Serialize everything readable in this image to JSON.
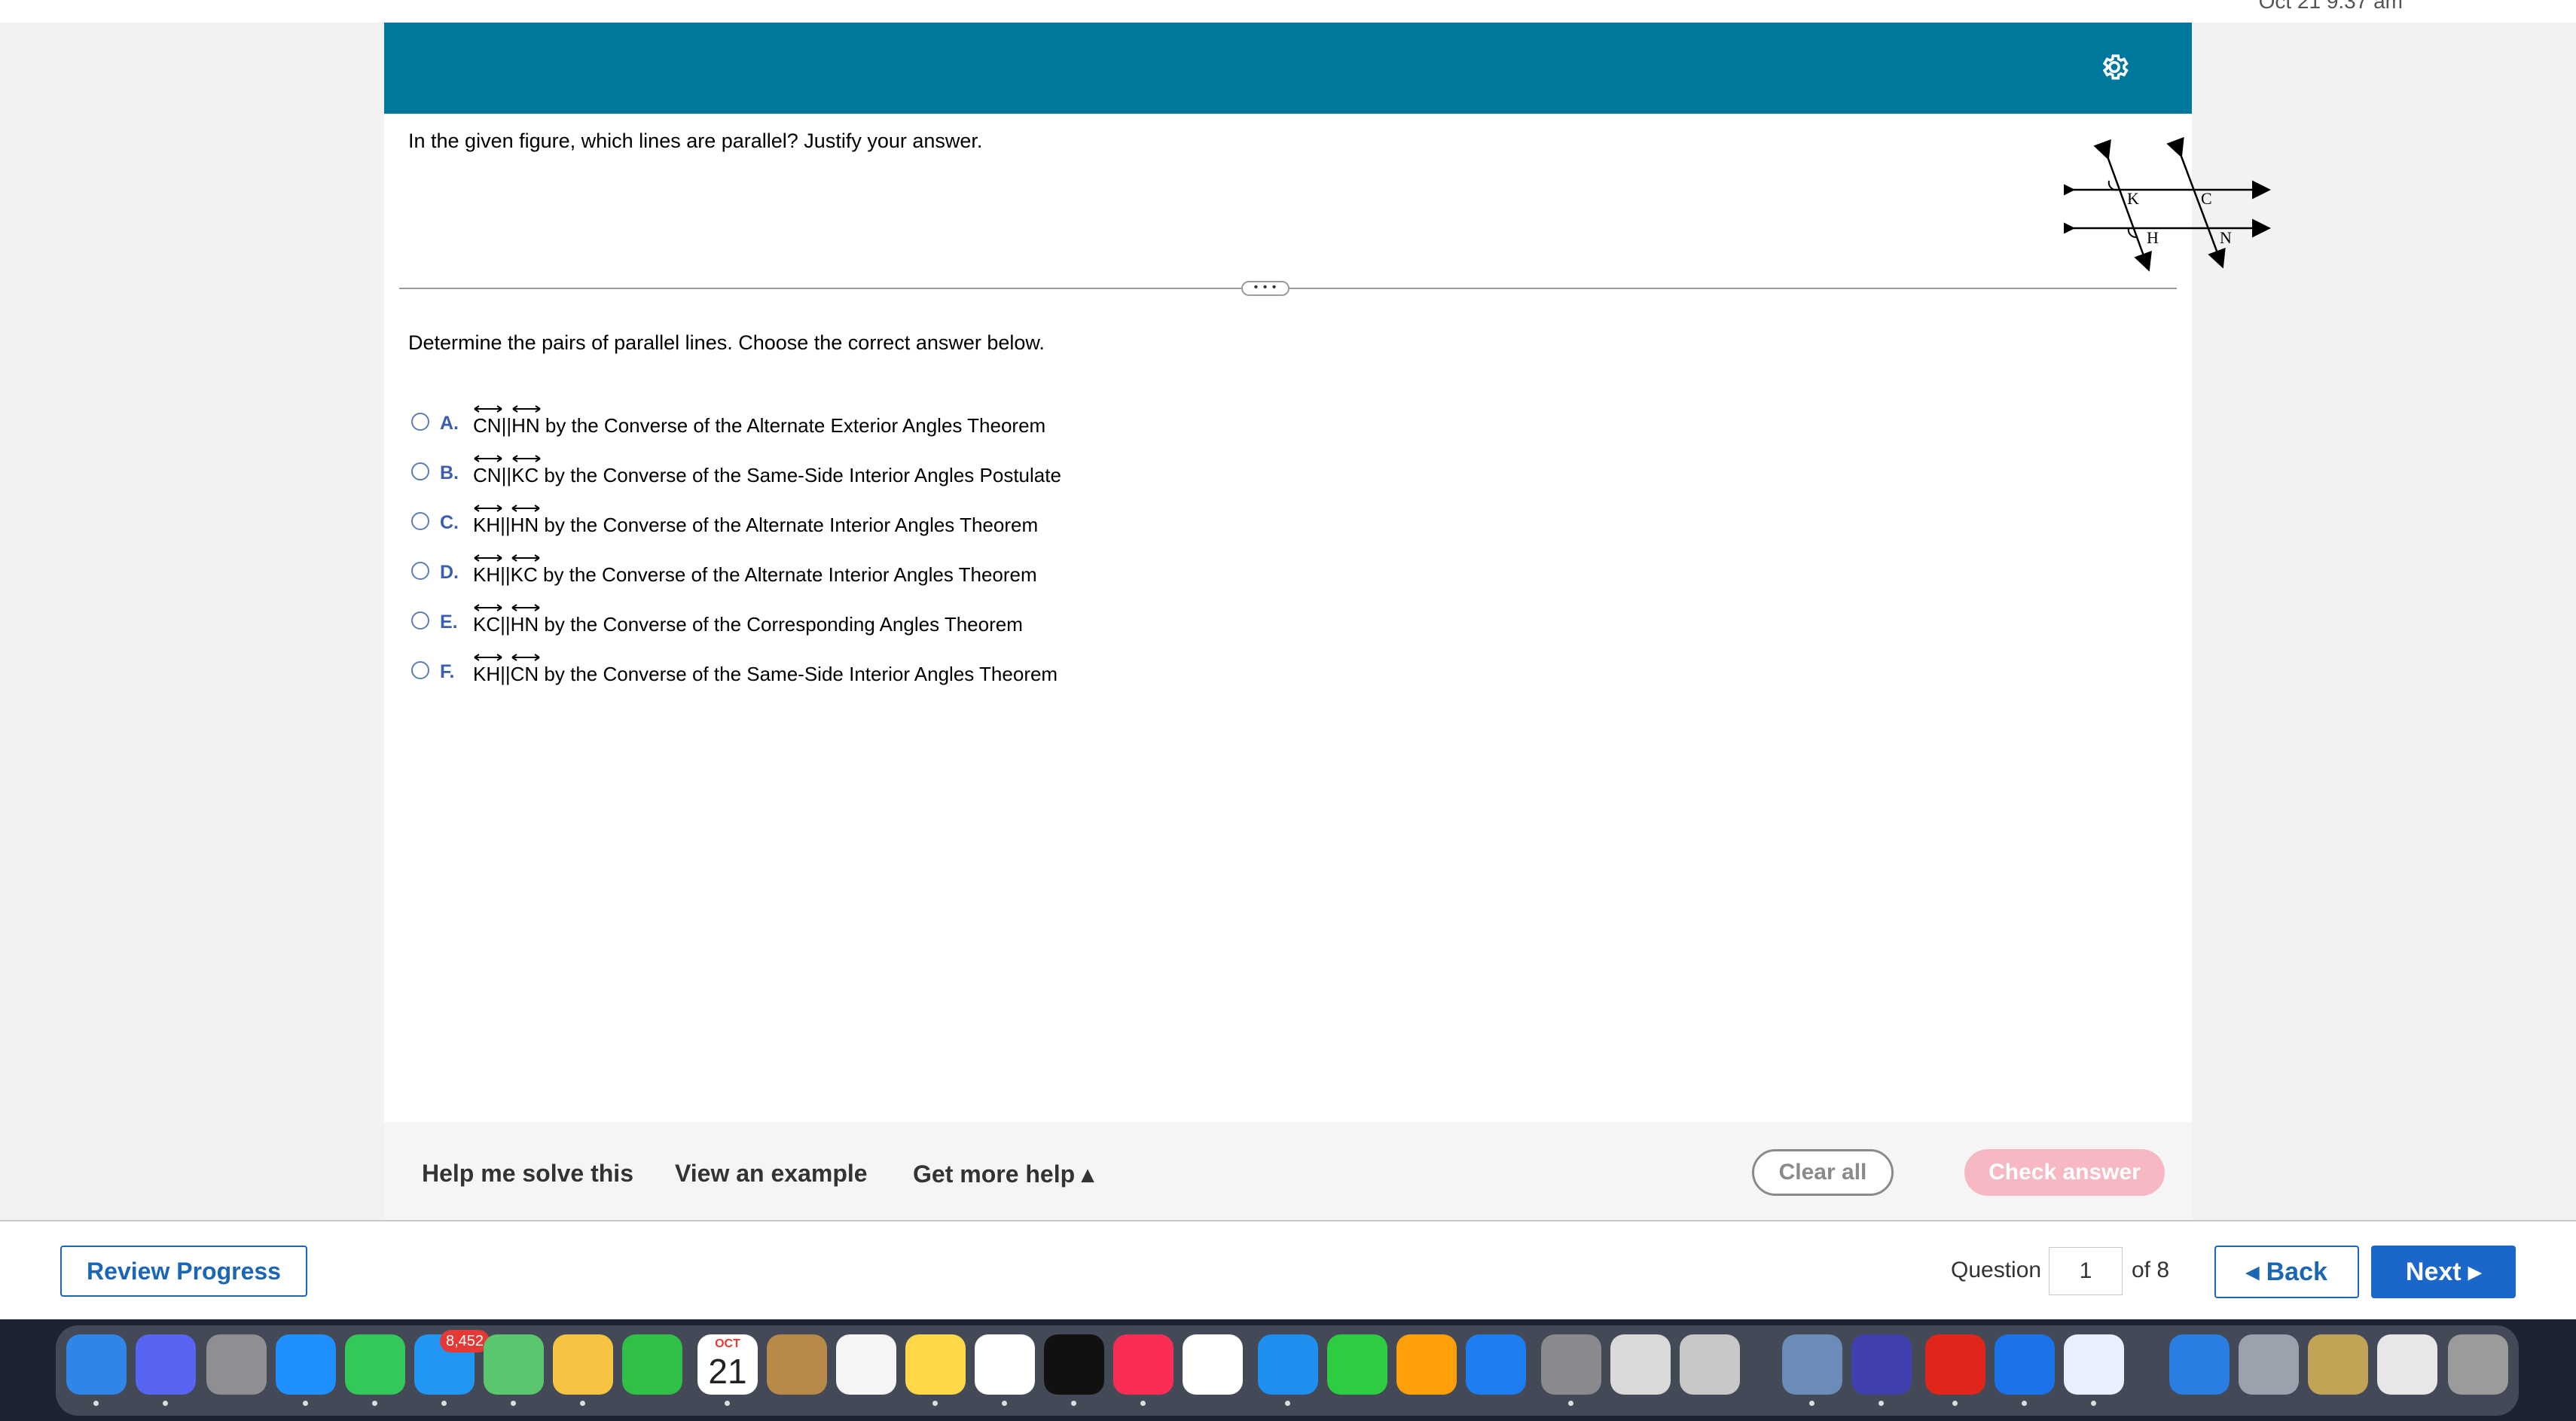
{
  "topbar": {
    "clock": "Oct 21  9:37 am"
  },
  "question": {
    "prompt": "In the given figure, which lines are parallel? Justify your answer.",
    "figure_labels": {
      "k": "K",
      "c": "C",
      "h": "H",
      "n": "N"
    },
    "divider_handle": "• • •",
    "instruction": "Determine the pairs of parallel lines. Choose the correct answer below."
  },
  "choices": [
    {
      "letter": "A.",
      "line1": "CN",
      "sep": "||",
      "line2": "HN",
      "reason": " by the Converse of the Alternate Exterior Angles Theorem"
    },
    {
      "letter": "B.",
      "line1": "CN",
      "sep": "||",
      "line2": "KC",
      "reason": " by the Converse of the Same-Side Interior Angles Postulate"
    },
    {
      "letter": "C.",
      "line1": "KH",
      "sep": "||",
      "line2": "HN",
      "reason": " by the Converse of the Alternate Interior Angles Theorem"
    },
    {
      "letter": "D.",
      "line1": "KH",
      "sep": "||",
      "line2": "KC",
      "reason": " by the Converse of the Alternate Interior Angles Theorem"
    },
    {
      "letter": "E.",
      "line1": "KC",
      "sep": "||",
      "line2": "HN",
      "reason": " by the Converse of the Corresponding Angles Theorem"
    },
    {
      "letter": "F.",
      "line1": "KH",
      "sep": "||",
      "line2": "CN",
      "reason": " by the Converse of the Same-Side Interior Angles Theorem"
    }
  ],
  "helpbar": {
    "help_solve": "Help me solve this",
    "view_example": "View an example",
    "more_help": "Get more help ▴",
    "clear_all": "Clear all",
    "check_answer": "Check answer"
  },
  "footer": {
    "review_progress": "Review Progress",
    "question_label": "Question",
    "question_number": "1",
    "of_total": "of 8",
    "back": "◂  Back",
    "next": "Next  ▸"
  },
  "dock": {
    "mail_badge": "8,452",
    "calendar_month": "OCT",
    "calendar_day": "21"
  },
  "colors": {
    "banner": "#00789d",
    "link_blue": "#1b66b5",
    "check_disabled": "#f6b8c2"
  }
}
